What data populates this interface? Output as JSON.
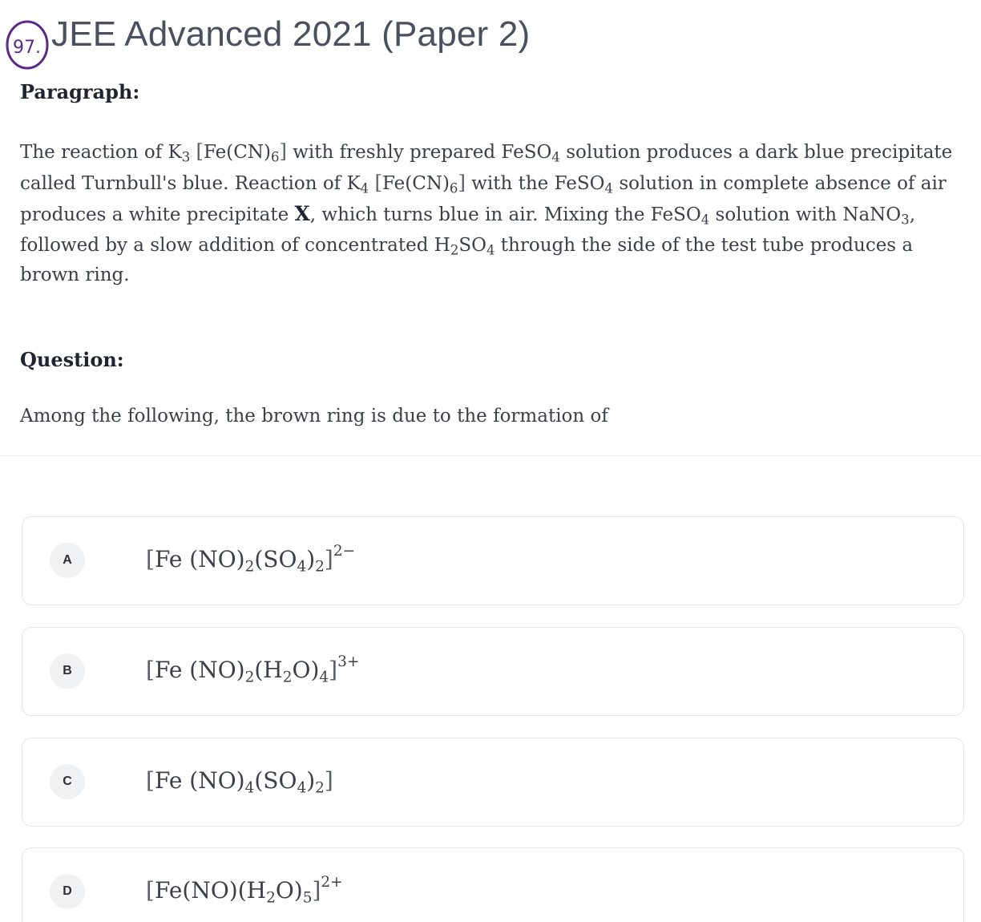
{
  "annotation": {
    "text": "97."
  },
  "header": {
    "title": "JEE Advanced 2021 (Paper 2)"
  },
  "paragraph": {
    "label": "Paragraph:",
    "t1": "The reaction of K",
    "t1_sub": "3",
    "t2": " with freshly prepared FeSO",
    "t2_sub": "4",
    "t3": " solution produces a dark blue precipitate called Turnbull's blue. Reaction of K",
    "t3_sub": "4",
    "t4": " with the FeSO",
    "t4_sub": "4",
    "t5": " solution in complete absence of air produces a white precipitate ",
    "x": "X",
    "t6": ", which turns blue in air. Mixing the FeSO",
    "t6_sub": "4",
    "t7": " solution with NaNO",
    "t7_sub": "3",
    "t8": ", followed by a slow addition of concentrated H",
    "t8_sub": "2",
    "t9": "SO",
    "t9_sub": "4",
    "t10": " through the side of the test tube produces a brown ring.",
    "complex_core": "Fe(CN)",
    "complex_sub": "6"
  },
  "question": {
    "label": "Question:",
    "text": "Among the following, the brown ring is due to the formation of"
  },
  "options": [
    {
      "letter": "A",
      "p1": "Fe (NO)",
      "s1": "2",
      "p2": "(SO",
      "s2": "4",
      "p3": ")",
      "s3": "2",
      "charge": "2−"
    },
    {
      "letter": "B",
      "p1": "Fe (NO)",
      "s1": "2",
      "p2": "(H",
      "s2": "2",
      "p3": "O)",
      "s3": "4",
      "charge": "3+"
    },
    {
      "letter": "C",
      "p1": "Fe (NO)",
      "s1": "4",
      "p2": "(SO",
      "s2": "4",
      "p3": ")",
      "s3": "2",
      "charge": ""
    },
    {
      "letter": "D",
      "p1": "Fe(NO)(H",
      "s1": "2",
      "p2": "O)",
      "s2": "5",
      "p3": "",
      "s3": "",
      "charge": "2+"
    }
  ]
}
